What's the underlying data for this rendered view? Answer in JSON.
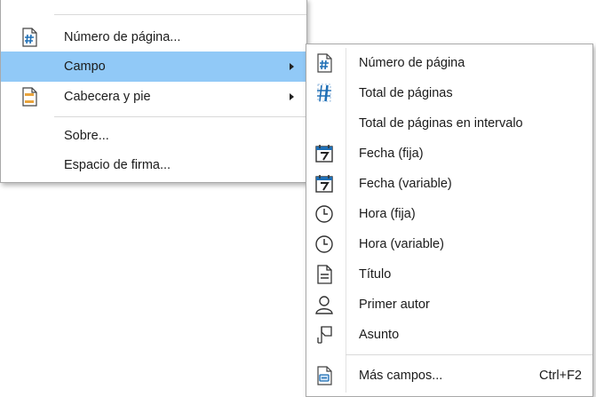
{
  "main_menu": {
    "items": [
      {
        "label": "Número de página...",
        "icon": "page-number-icon"
      },
      {
        "label": "Campo",
        "icon": null,
        "has_submenu": true,
        "highlighted": true
      },
      {
        "label": "Cabecera y pie",
        "icon": "header-footer-icon",
        "has_submenu": true
      },
      {
        "label": "Sobre...",
        "icon": null
      },
      {
        "label": "Espacio de firma...",
        "icon": null
      }
    ]
  },
  "field_submenu": {
    "items": [
      {
        "label": "Número de página",
        "icon": "page-number-icon"
      },
      {
        "label": "Total de páginas",
        "icon": "page-count-icon"
      },
      {
        "label": "Total de páginas en intervalo",
        "icon": null
      },
      {
        "label": "Fecha (fija)",
        "icon": "calendar-icon"
      },
      {
        "label": "Fecha (variable)",
        "icon": "calendar-icon"
      },
      {
        "label": "Hora (fija)",
        "icon": "clock-icon"
      },
      {
        "label": "Hora (variable)",
        "icon": "clock-icon"
      },
      {
        "label": "Título",
        "icon": "document-icon"
      },
      {
        "label": "Primer autor",
        "icon": "person-icon"
      },
      {
        "label": "Asunto",
        "icon": "subject-icon"
      },
      {
        "label": "Más campos...",
        "icon": "more-fields-icon",
        "shortcut": "Ctrl+F2"
      }
    ]
  },
  "colors": {
    "highlight": "#91c9f7",
    "icon_blue": "#1f6fb5",
    "icon_orange": "#e8a33c",
    "text": "#1b1b1b"
  }
}
